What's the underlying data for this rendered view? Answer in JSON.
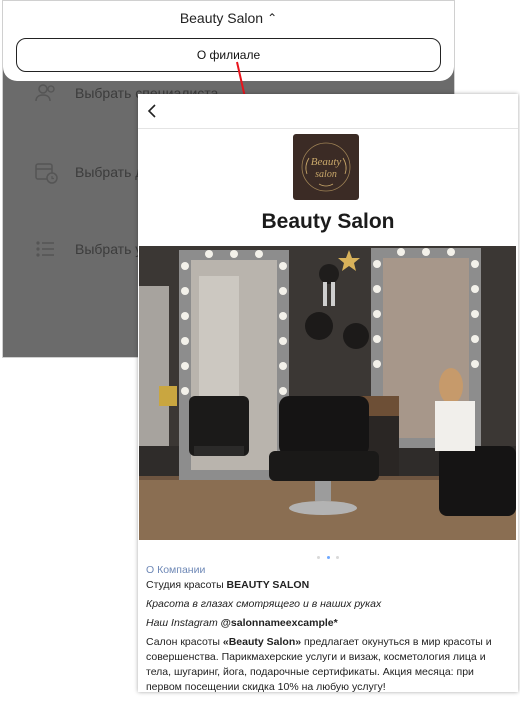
{
  "back_screen": {
    "branch_title": "Beauty Salon",
    "about_button": "О филиале",
    "menu": [
      {
        "label": "Выбрать специалиста",
        "icon": "users-icon"
      },
      {
        "label": "Выбрать дату и время",
        "icon": "calendar-clock-icon"
      },
      {
        "label": "Выбрать услуги",
        "icon": "list-icon"
      }
    ]
  },
  "card": {
    "salon_name": "Beauty Salon",
    "logo_text": "Beauty salon",
    "carousel": {
      "count": 3,
      "active": 1
    },
    "info": {
      "section_label": "О Компании",
      "studio_prefix": "Студия красоты ",
      "studio_name": "BEAUTY SALON",
      "tagline": "Красота в глазах смотрящего и в наших руках",
      "instagram_prefix": "Наш Instagram ",
      "instagram_handle": "@salonnameexcample*",
      "desc_prefix": "Салон красоты ",
      "desc_name": "«Beauty Salon»",
      "desc_rest": " предлагает окунуться в мир красоты и совершенства. Парикмахерские услуги и визаж, косметология лица и тела, шугаринг, йога, подарочные сертификаты. Акция месяца: при первом посещении скидка 10% на любую услугу!"
    }
  },
  "colors": {
    "overlay": "#6b6b6b",
    "arrow": "#e8141c",
    "section_label": "#6e88b6",
    "logo_bg": "#3b2b25",
    "logo_gold": "#c9a86a"
  }
}
